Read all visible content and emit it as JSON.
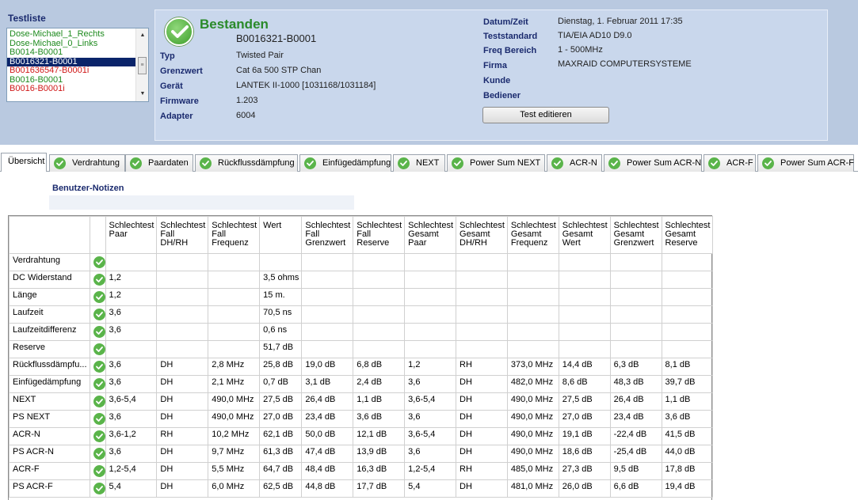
{
  "testliste": {
    "title": "Testliste",
    "items": [
      {
        "label": "Dose-Michael_1_Rechts",
        "state": "green"
      },
      {
        "label": "Dose-Michael_0_Links",
        "state": "green"
      },
      {
        "label": "B0014-B0001",
        "state": "green"
      },
      {
        "label": "B0016321-B0001",
        "state": "selected"
      },
      {
        "label": "B001636547-B0001i",
        "state": "red"
      },
      {
        "label": "B0016-B0001",
        "state": "green"
      },
      {
        "label": "B0016-B0001i",
        "state": "red"
      }
    ]
  },
  "header": {
    "status": "Bestanden",
    "test_id": "B0016321-B0001",
    "left_fields": [
      {
        "label": "Typ",
        "value": "Twisted Pair"
      },
      {
        "label": "Grenzwert",
        "value": "Cat 6a 500 STP Chan"
      },
      {
        "label": "Gerät",
        "value": "LANTEK II-1000 [1031168/1031184]"
      },
      {
        "label": "Firmware",
        "value": "1.203"
      },
      {
        "label": "Adapter",
        "value": "6004"
      }
    ],
    "right_fields": [
      {
        "label": "Datum/Zeit",
        "value": "Dienstag, 1. Februar 2011 17:35"
      },
      {
        "label": "Teststandard",
        "value": "TIA/EIA AD10 D9.0"
      },
      {
        "label": "Freq Bereich",
        "value": "1 - 500MHz"
      },
      {
        "label": "Firma",
        "value": "MAXRAID COMPUTERSYSTEME"
      },
      {
        "label": "Kunde",
        "value": ""
      },
      {
        "label": "Bediener",
        "value": ""
      }
    ],
    "edit_button": "Test editieren"
  },
  "tabs": [
    {
      "label": "Übersicht",
      "icon": false,
      "active": true
    },
    {
      "label": "Verdrahtung",
      "icon": true
    },
    {
      "label": "Paardaten",
      "icon": true
    },
    {
      "label": "Rückflussdämpfung",
      "icon": true
    },
    {
      "label": "Einfügedämpfung",
      "icon": true
    },
    {
      "label": "NEXT",
      "icon": true
    },
    {
      "label": "Power Sum NEXT",
      "icon": true
    },
    {
      "label": "ACR-N",
      "icon": true
    },
    {
      "label": "Power Sum ACR-N",
      "icon": true
    },
    {
      "label": "ACR-F",
      "icon": true
    },
    {
      "label": "Power Sum ACR-F",
      "icon": true
    }
  ],
  "notes": {
    "title": "Benutzer-Notizen",
    "value": ""
  },
  "table": {
    "headers": [
      "",
      "",
      "Schlechtest\nPaar",
      "Schlechtest\nFall\nDH/RH",
      "Schlechtest\nFall\nFrequenz",
      "Wert",
      "Schlechtest\nFall\nGrenzwert",
      "Schlechtest\nFall\nReserve",
      "Schlechtest\nGesamt\nPaar",
      "Schlechtest\nGesamt\nDH/RH",
      "Schlechtest\nGesamt\nFrequenz",
      "Schlechtest\nGesamt\nWert",
      "Schlechtest\nGesamt\nGrenzwert",
      "Schlechtest\nGesamt\nReserve"
    ],
    "rows": [
      [
        "Verdrahtung",
        "",
        "",
        "",
        "",
        "",
        "",
        "",
        "",
        "",
        "",
        "",
        ""
      ],
      [
        "DC Widerstand",
        "1,2",
        "",
        "",
        "3,5 ohms",
        "",
        "",
        "",
        "",
        "",
        "",
        "",
        ""
      ],
      [
        "Länge",
        "1,2",
        "",
        "",
        "15 m.",
        "",
        "",
        "",
        "",
        "",
        "",
        "",
        ""
      ],
      [
        "Laufzeit",
        "3,6",
        "",
        "",
        "70,5 ns",
        "",
        "",
        "",
        "",
        "",
        "",
        "",
        ""
      ],
      [
        "Laufzeitdifferenz",
        "3,6",
        "",
        "",
        "0,6 ns",
        "",
        "",
        "",
        "",
        "",
        "",
        "",
        ""
      ],
      [
        "Reserve",
        "",
        "",
        "",
        "51,7 dB",
        "",
        "",
        "",
        "",
        "",
        "",
        "",
        ""
      ],
      [
        "Rückflussdämpfu...",
        "3,6",
        "DH",
        "2,8 MHz",
        "25,8 dB",
        "19,0 dB",
        "6,8 dB",
        "1,2",
        "RH",
        "373,0 MHz",
        "14,4 dB",
        "6,3 dB",
        "8,1 dB"
      ],
      [
        "Einfügedämpfung",
        "3,6",
        "DH",
        "2,1 MHz",
        "0,7 dB",
        "3,1 dB",
        "2,4 dB",
        "3,6",
        "DH",
        "482,0 MHz",
        "8,6 dB",
        "48,3 dB",
        "39,7 dB"
      ],
      [
        "NEXT",
        "3,6-5,4",
        "DH",
        "490,0 MHz",
        "27,5 dB",
        "26,4 dB",
        "1,1 dB",
        "3,6-5,4",
        "DH",
        "490,0 MHz",
        "27,5 dB",
        "26,4 dB",
        "1,1 dB"
      ],
      [
        "PS NEXT",
        "3,6",
        "DH",
        "490,0 MHz",
        "27,0 dB",
        "23,4 dB",
        "3,6 dB",
        "3,6",
        "DH",
        "490,0 MHz",
        "27,0 dB",
        "23,4 dB",
        "3,6 dB"
      ],
      [
        "ACR-N",
        "3,6-1,2",
        "RH",
        "10,2 MHz",
        "62,1 dB",
        "50,0 dB",
        "12,1 dB",
        "3,6-5,4",
        "DH",
        "490,0 MHz",
        "19,1 dB",
        "-22,4 dB",
        "41,5 dB"
      ],
      [
        "PS ACR-N",
        "3,6",
        "DH",
        "9,7 MHz",
        "61,3 dB",
        "47,4 dB",
        "13,9 dB",
        "3,6",
        "DH",
        "490,0 MHz",
        "18,6 dB",
        "-25,4 dB",
        "44,0 dB"
      ],
      [
        "ACR-F",
        "1,2-5,4",
        "DH",
        "5,5 MHz",
        "64,7 dB",
        "48,4 dB",
        "16,3 dB",
        "1,2-5,4",
        "RH",
        "485,0 MHz",
        "27,3 dB",
        "9,5 dB",
        "17,8 dB"
      ],
      [
        "PS ACR-F",
        "5,4",
        "DH",
        "6,0 MHz",
        "62,5 dB",
        "44,8 dB",
        "17,7 dB",
        "5,4",
        "DH",
        "481,0 MHz",
        "26,0 dB",
        "6,6 dB",
        "19,4 dB"
      ]
    ]
  },
  "colors": {
    "pass_green": "#5ab44a",
    "header_navy": "#1a2a6e",
    "fail_red": "#d01818"
  }
}
